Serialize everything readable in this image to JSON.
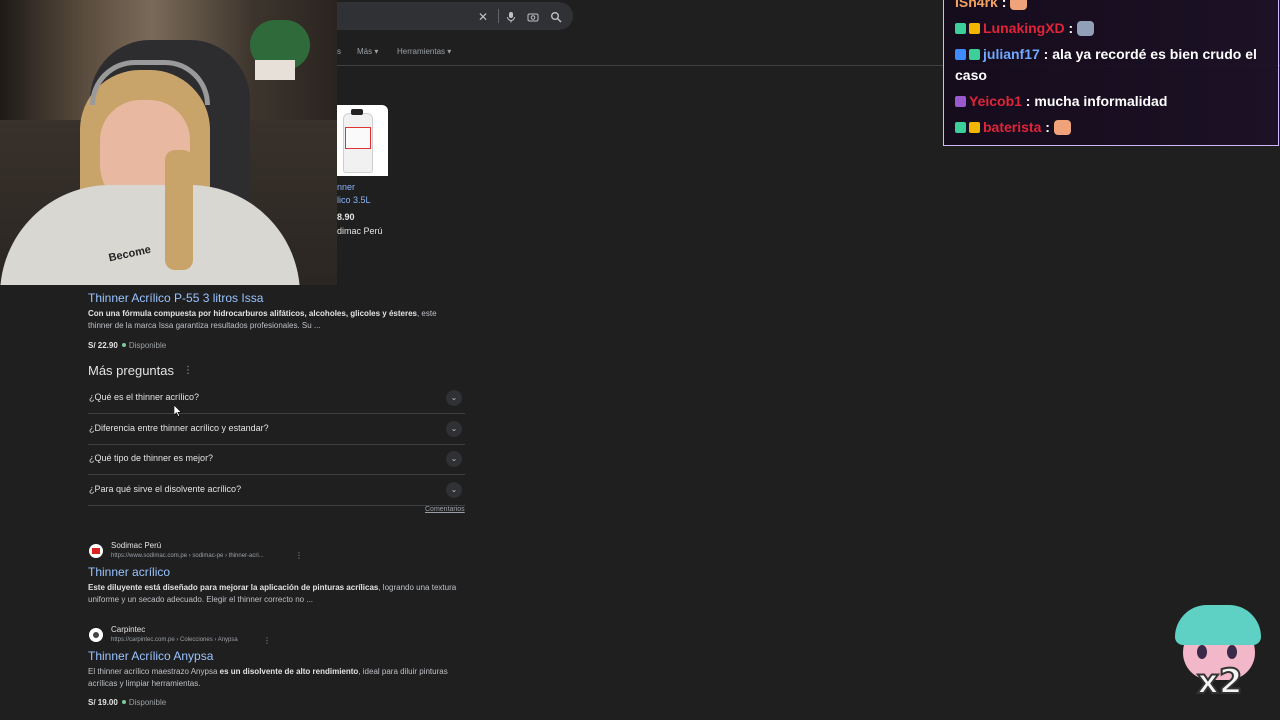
{
  "search": {
    "nav": [
      "s",
      "Más ▾",
      "Herramientas ▾"
    ]
  },
  "product_card": {
    "title_line1": "nner",
    "title_line2": "lico 3.5L",
    "price": "8.90",
    "store": "dimac Perú"
  },
  "result_issa": {
    "title": "Thinner Acrílico P-55 3 litros Issa",
    "snippet_bold": "Con una fórmula compuesta por hidrocarburos alifáticos, alcoholes, glicoles y ésteres",
    "snippet_rest": ", este",
    "snippet_line2": "thinner de la marca Issa garantiza resultados profesionales. Su ...",
    "price": "S/ 22.90",
    "availability": "Disponible"
  },
  "ppa": {
    "title": "Más preguntas",
    "questions": [
      "¿Qué es el thinner acrílico?",
      "¿Diferencia entre thinner acrílico y estandar?",
      "¿Qué tipo de thinner es mejor?",
      "¿Para qué sirve el disolvente acrílico?"
    ],
    "feedback": "Comentarios"
  },
  "result_sodimac": {
    "site": "Sodimac Perú",
    "url": "https://www.sodimac.com.pe › sodimac-pe › thinner-acri...",
    "title": "Thinner acrílico",
    "snippet_bold": "Este diluyente está diseñado para mejorar la aplicación de pinturas acrílicas",
    "snippet_rest": ", logrando una textura",
    "snippet_line2": "uniforme y un secado adecuado. Elegir el thinner correcto no ..."
  },
  "result_carpintec": {
    "site": "Carpintec",
    "url": "https://carpintec.com.pe › Colecciones › Anypsa",
    "title": "Thinner Acrílico Anypsa",
    "snippet_start": "El thinner acrílico maestrazo Anypsa ",
    "snippet_bold": "es un disolvente de alto rendimiento",
    "snippet_rest": ", ideal para diluir pinturas",
    "snippet_line2": "acrílicas y limpiar herramientas.",
    "price": "S/ 19.00",
    "availability": "Disponible"
  },
  "webcam": {
    "shirt_text": "Become"
  },
  "chat": {
    "messages": [
      {
        "user": "ISh4rk",
        "user_color": "#f4a261",
        "text": ""
      },
      {
        "user": "LunakingXD",
        "user_color": "#e0243a",
        "text": ""
      },
      {
        "user": "julianf17",
        "user_color": "#6fa8ff",
        "text": "ala ya recordé es bien crudo el caso"
      },
      {
        "user": "Yeicob1",
        "user_color": "#e0243a",
        "text": "mucha informalidad"
      },
      {
        "user": "baterista",
        "user_color": "#e0243a",
        "text": ""
      }
    ],
    "separator": " :"
  },
  "sticker": {
    "label": "x2"
  }
}
